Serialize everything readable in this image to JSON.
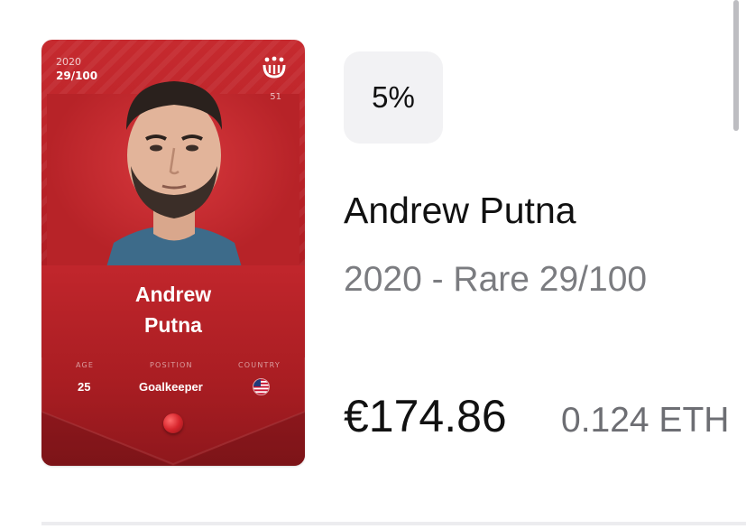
{
  "card": {
    "year": "2020",
    "serial": "29/100",
    "rank": "51",
    "name_line1": "Andrew",
    "name_line2": "Putna",
    "stats": {
      "age_label": "AGE",
      "age_value": "25",
      "position_label": "POSITION",
      "position_value": "Goalkeeper",
      "country_label": "COUNTRY"
    },
    "country_flag": "us-flag-icon",
    "colors": {
      "card_red": "#c62a2f"
    }
  },
  "badge": {
    "percent": "5%"
  },
  "detail": {
    "title": "Andrew Putna",
    "subtitle": "2020 - Rare 29/100",
    "price_eur": "€174.86",
    "price_eth": "0.124 ETH"
  }
}
